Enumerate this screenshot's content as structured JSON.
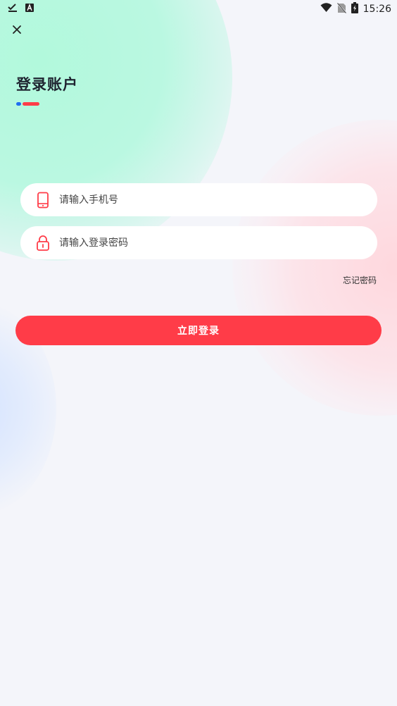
{
  "status_bar": {
    "time": "15:26",
    "left_icons": [
      "checkmark-download-icon",
      "a-letter-icon"
    ],
    "right_icons": [
      "wifi-icon",
      "no-sim-icon",
      "battery-charging-icon"
    ]
  },
  "header": {
    "close_icon": "close-icon",
    "title": "登录账户"
  },
  "form": {
    "phone": {
      "icon": "phone-icon",
      "placeholder": "请输入手机号",
      "value": ""
    },
    "password": {
      "icon": "lock-icon",
      "placeholder": "请输入登录密码",
      "value": ""
    },
    "forgot_label": "忘记密码",
    "submit_label": "立即登录"
  },
  "colors": {
    "accent_red": "#ff3c48",
    "accent_blue": "#1f6df0",
    "background": "#f4f5fa"
  }
}
